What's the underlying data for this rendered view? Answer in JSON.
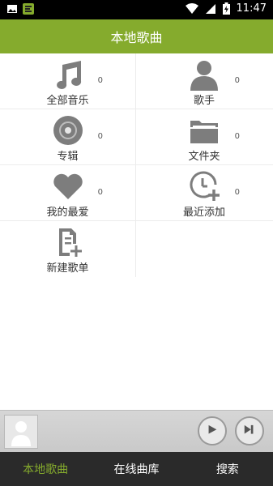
{
  "status_bar": {
    "time": "11:47"
  },
  "header": {
    "title": "本地歌曲"
  },
  "grid": [
    {
      "label": "全部音乐",
      "count": "0",
      "icon": "music-note-icon"
    },
    {
      "label": "歌手",
      "count": "0",
      "icon": "person-icon"
    },
    {
      "label": "专辑",
      "count": "0",
      "icon": "disc-icon"
    },
    {
      "label": "文件夹",
      "count": "0",
      "icon": "folder-icon"
    },
    {
      "label": "我的最爱",
      "count": "0",
      "icon": "heart-icon"
    },
    {
      "label": "最近添加",
      "count": "0",
      "icon": "clock-add-icon"
    },
    {
      "label": "新建歌单",
      "icon": "new-playlist-icon"
    }
  ],
  "player": {
    "play_icon": "play-icon",
    "next_icon": "skip-next-icon"
  },
  "tabs": [
    {
      "label": "本地歌曲",
      "active": true
    },
    {
      "label": "在线曲库"
    },
    {
      "label": "搜索"
    }
  ],
  "colors": {
    "accent": "#85ab2d",
    "nav_bg": "#2a2a2a",
    "icon_gray": "#7d7d7d"
  }
}
